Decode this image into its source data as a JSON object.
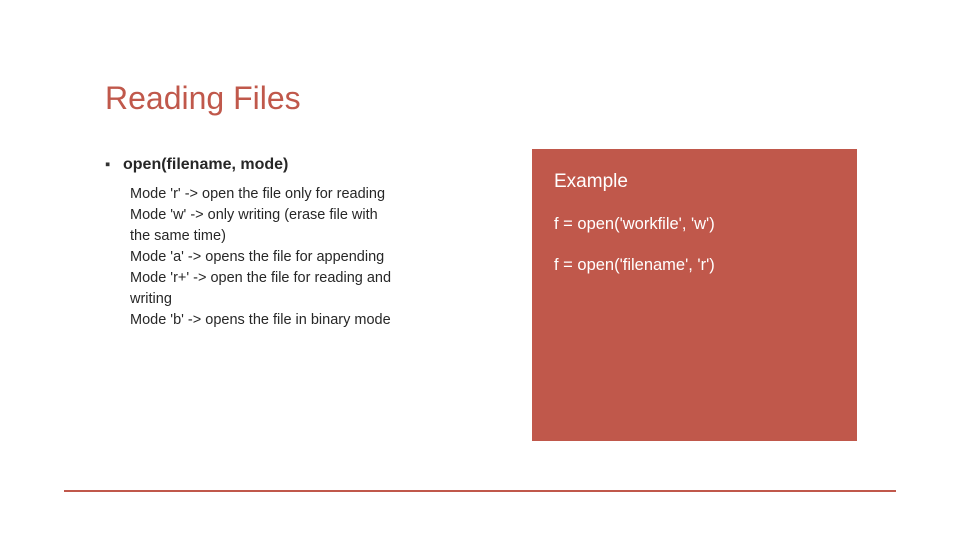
{
  "title": "Reading Files",
  "bullet_symbol": "▪",
  "heading": "open(filename, mode)",
  "modes": {
    "l0": "Mode 'r' -> open the file only for reading",
    "l1": "Mode 'w' -> only writing (erase file with",
    "l2": "the same time)",
    "l3": "Mode 'a' -> opens the file for appending",
    "l4": "Mode 'r+' -> open the file for reading and",
    "l5": "writing",
    "l6": "Mode 'b' -> opens the file in binary mode"
  },
  "example": {
    "title": "Example",
    "line1": "f = open('workfile', 'w')",
    "line2": "f = open('filename', 'r')"
  }
}
